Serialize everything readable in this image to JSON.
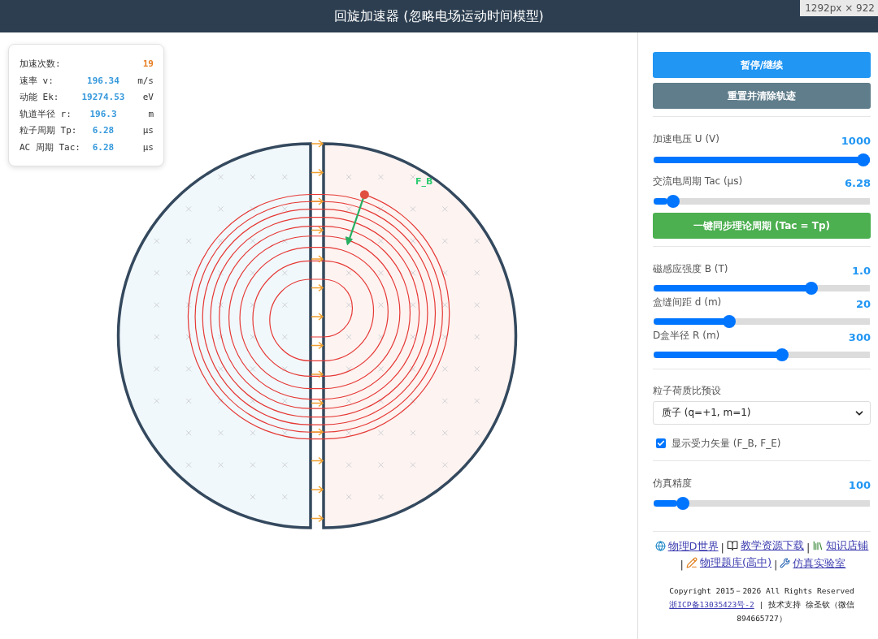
{
  "title": "回旋加速器 (忽略电场运动时间模型)",
  "size_badge": "1292px × 922",
  "stats": [
    {
      "label": "加速次数:",
      "value": "19",
      "kind": "count"
    },
    {
      "label": "速率 v:",
      "value": "196.34",
      "unit": "m/s",
      "kind": "value"
    },
    {
      "label": "动能 Ek:",
      "value": "19274.53",
      "unit": "eV",
      "kind": "value"
    },
    {
      "label": "轨道半径 r:",
      "value": "196.3",
      "unit": "m",
      "kind": "value"
    },
    {
      "label": "粒子周期 Tp:",
      "value": "6.28",
      "unit": "µs",
      "kind": "value"
    },
    {
      "label": "AC 周期 Tac:",
      "value": "6.28",
      "unit": "µs",
      "kind": "value"
    }
  ],
  "force_label": "F_B",
  "buttons": [
    {
      "label": "暂停/继续",
      "kind": "primary"
    },
    {
      "label": "重置并清除轨迹",
      "kind": "secondary"
    }
  ],
  "ac_sliders": [
    {
      "label": "加速电压 U (V)",
      "value": "1000",
      "level": 1.0
    },
    {
      "label": "交流电周期 Tac (µs)",
      "value": "6.28",
      "level": 0.065
    }
  ],
  "sync_button": "一键同步理论周期 (Tac = Tp)",
  "field_sliders": [
    {
      "label": "磁感应强度 B (T)",
      "value": "1.0",
      "level": 0.745
    },
    {
      "label": "盒缝间距 d (m)",
      "value": "20",
      "level": 0.34
    },
    {
      "label": "D盒半径 R (m)",
      "value": "300",
      "level": 0.6
    }
  ],
  "preset": {
    "label": "粒子荷质比预设",
    "value": "质子 (q=+1, m=1)"
  },
  "show_forces": {
    "label": "显示受力矢量 (F_B, F_E)",
    "checked": true
  },
  "precision_slider": {
    "label": "仿真精度",
    "value": "100",
    "level": 0.11
  },
  "footer_links": [
    {
      "kind": "link",
      "text": "物理D世界"
    },
    {
      "kind": "separator",
      "text": "|"
    },
    {
      "kind": "link",
      "text": "教学资源下载"
    },
    {
      "kind": "separator",
      "text": "|"
    },
    {
      "kind": "link",
      "text": "知识店铺"
    },
    {
      "kind": "separator",
      "text": "|"
    },
    {
      "kind": "link",
      "text": "物理题库(高中)"
    },
    {
      "kind": "separator",
      "text": "|"
    },
    {
      "kind": "link",
      "text": "仿真实验室"
    }
  ],
  "copyright": "Copyright 2015－2026 All Rights Reserved",
  "icp_link": "浙ICP备13035423号-2",
  "credit_separator": "|",
  "credit": [
    "技术支持 徐圣钦（微信",
    "894665727）"
  ]
}
